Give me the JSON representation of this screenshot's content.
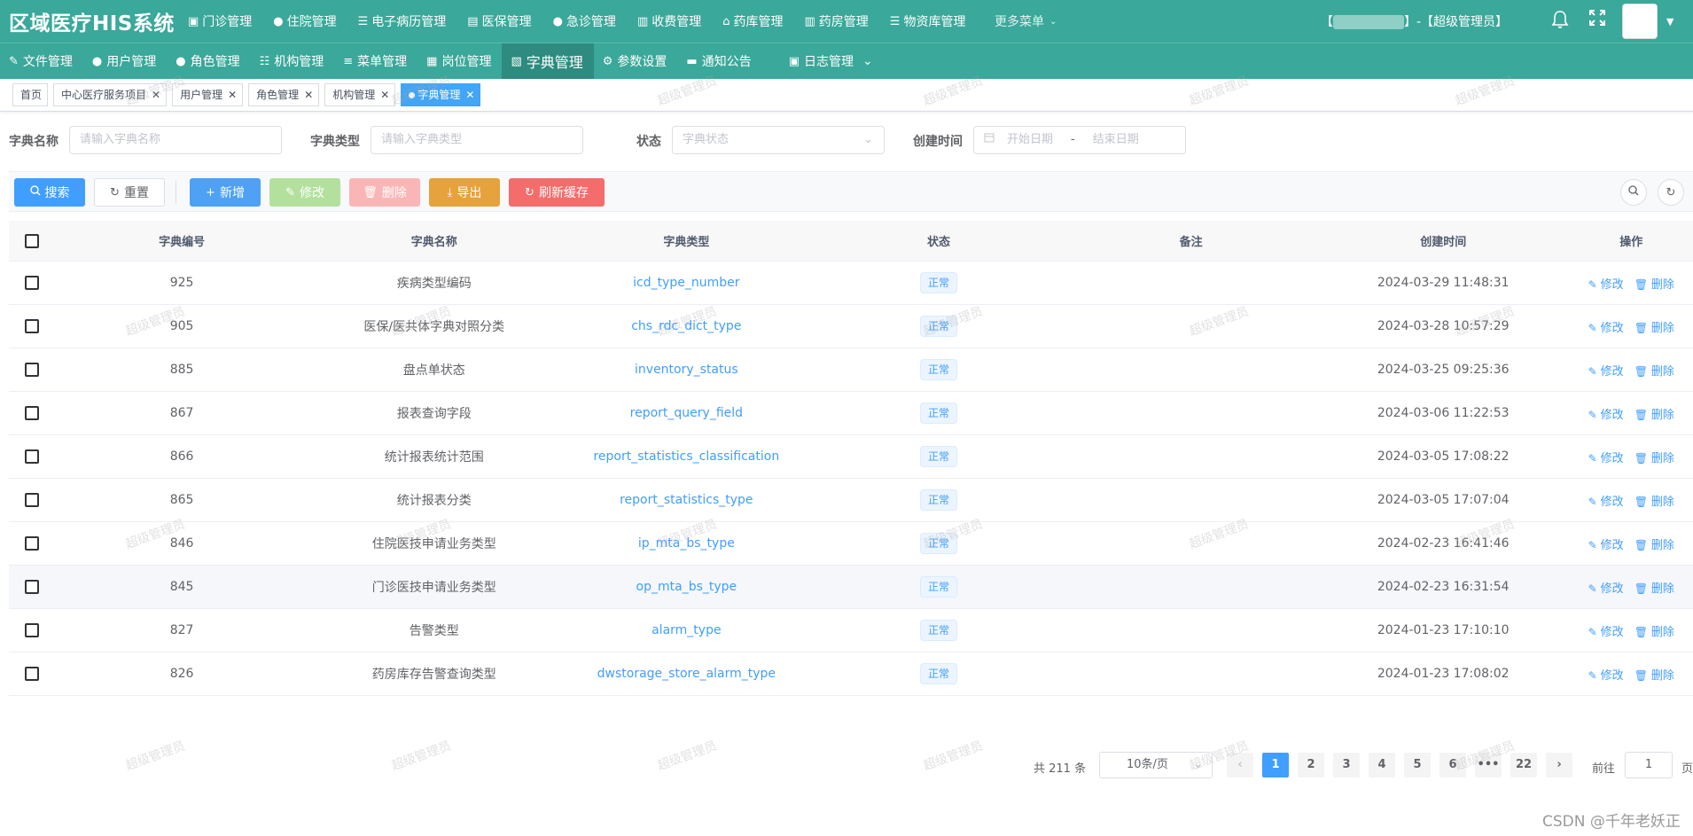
{
  "app": {
    "title": "区域医疗HIS系统"
  },
  "top_menu": [
    {
      "label": "门诊管理",
      "icon": "clinic-icon"
    },
    {
      "label": "住院管理",
      "icon": "user-icon"
    },
    {
      "label": "电子病历管理",
      "icon": "list-icon"
    },
    {
      "label": "医保管理",
      "icon": "building-icon"
    },
    {
      "label": "急诊管理",
      "icon": "user-icon"
    },
    {
      "label": "收费管理",
      "icon": "document-icon"
    },
    {
      "label": "药库管理",
      "icon": "home-icon"
    },
    {
      "label": "药房管理",
      "icon": "document-icon"
    },
    {
      "label": "物资库管理",
      "icon": "list-icon"
    }
  ],
  "more_menu_label": "更多菜单",
  "user": {
    "prefix": "【",
    "suffix": "】-【超级管理员】"
  },
  "sub_menu": [
    {
      "label": "文件管理",
      "icon": "edit-icon"
    },
    {
      "label": "用户管理",
      "icon": "user-icon"
    },
    {
      "label": "角色管理",
      "icon": "users-icon"
    },
    {
      "label": "机构管理",
      "icon": "tree-icon"
    },
    {
      "label": "菜单管理",
      "icon": "tree-table-icon"
    },
    {
      "label": "岗位管理",
      "icon": "post-icon"
    },
    {
      "label": "字典管理",
      "icon": "dict-icon",
      "active": true
    },
    {
      "label": "参数设置",
      "icon": "settings-icon"
    },
    {
      "label": "通知公告",
      "icon": "message-icon"
    },
    {
      "label": "日志管理",
      "icon": "log-icon"
    }
  ],
  "tags": [
    {
      "label": "首页",
      "closable": false
    },
    {
      "label": "中心医疗服务项目",
      "closable": true
    },
    {
      "label": "用户管理",
      "closable": true
    },
    {
      "label": "角色管理",
      "closable": true
    },
    {
      "label": "机构管理",
      "closable": true
    },
    {
      "label": "字典管理",
      "closable": true,
      "active": true
    }
  ],
  "filters": {
    "dict_name": {
      "label": "字典名称",
      "placeholder": "请输入字典名称"
    },
    "dict_type": {
      "label": "字典类型",
      "placeholder": "请输入字典类型"
    },
    "status": {
      "label": "状态",
      "placeholder": "字典状态"
    },
    "created": {
      "label": "创建时间",
      "start_placeholder": "开始日期",
      "separator": "-",
      "end_placeholder": "结束日期"
    }
  },
  "toolbar": {
    "search": "搜索",
    "reset": "重置",
    "add": "新增",
    "edit": "修改",
    "delete": "删除",
    "export": "导出",
    "refresh_cache": "刷新缓存"
  },
  "table": {
    "columns": [
      "字典编号",
      "字典名称",
      "字典类型",
      "状态",
      "备注",
      "创建时间",
      "操作"
    ],
    "rows": [
      {
        "id": "925",
        "name": "疾病类型编码",
        "type": "icd_type_number",
        "status": "正常",
        "remark": "",
        "created": "2024-03-29 11:48:31"
      },
      {
        "id": "905",
        "name": "医保/医共体字典对照分类",
        "type": "chs_rdc_dict_type",
        "status": "正常",
        "remark": "",
        "created": "2024-03-28 10:57:29"
      },
      {
        "id": "885",
        "name": "盘点单状态",
        "type": "inventory_status",
        "status": "正常",
        "remark": "",
        "created": "2024-03-25 09:25:36"
      },
      {
        "id": "867",
        "name": "报表查询字段",
        "type": "report_query_field",
        "status": "正常",
        "remark": "",
        "created": "2024-03-06 11:22:53"
      },
      {
        "id": "866",
        "name": "统计报表统计范围",
        "type": "report_statistics_classification",
        "status": "正常",
        "remark": "",
        "created": "2024-03-05 17:08:22"
      },
      {
        "id": "865",
        "name": "统计报表分类",
        "type": "report_statistics_type",
        "status": "正常",
        "remark": "",
        "created": "2024-03-05 17:07:04"
      },
      {
        "id": "846",
        "name": "住院医技申请业务类型",
        "type": "ip_mta_bs_type",
        "status": "正常",
        "remark": "",
        "created": "2024-02-23 16:41:46"
      },
      {
        "id": "845",
        "name": "门诊医技申请业务类型",
        "type": "op_mta_bs_type",
        "status": "正常",
        "remark": "",
        "created": "2024-02-23 16:31:54"
      },
      {
        "id": "827",
        "name": "告警类型",
        "type": "alarm_type",
        "status": "正常",
        "remark": "",
        "created": "2024-01-23 17:10:10"
      },
      {
        "id": "826",
        "name": "药房库存告警查询类型",
        "type": "dwstorage_store_alarm_type",
        "status": "正常",
        "remark": "",
        "created": "2024-01-23 17:08:02"
      }
    ],
    "row_actions": {
      "edit": "修改",
      "delete": "删除"
    }
  },
  "pagination": {
    "total_text": "共 211 条",
    "page_size": "10条/页",
    "pages": [
      "1",
      "2",
      "3",
      "4",
      "5",
      "6",
      "•••",
      "22"
    ],
    "current": "1",
    "goto_label": "前往",
    "goto_value": "1",
    "goto_unit": "页"
  },
  "watermark_text": "超级管理员",
  "footer_credit": "CSDN @千年老妖正"
}
